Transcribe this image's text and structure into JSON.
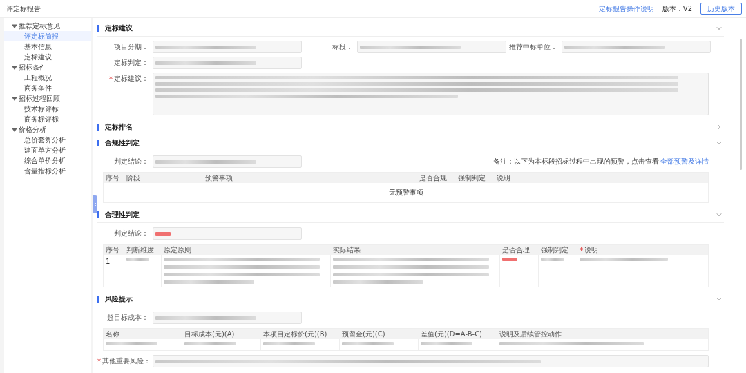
{
  "header": {
    "title": "评定标报告",
    "help_link": "定标报告操作说明",
    "version_label": "版本：",
    "version": "V2",
    "history_button": "历史版本"
  },
  "sidebar": {
    "items": [
      {
        "label": "推荐定标意见",
        "expanded": true,
        "children": [
          {
            "label": "评定标简报",
            "selected": true
          },
          {
            "label": "基本信息",
            "selected": false
          },
          {
            "label": "定标建议",
            "selected": false
          }
        ]
      },
      {
        "label": "招标条件",
        "expanded": true,
        "children": [
          {
            "label": "工程概况",
            "selected": false
          },
          {
            "label": "商务条件",
            "selected": false
          }
        ]
      },
      {
        "label": "招标过程回顾",
        "expanded": true,
        "children": [
          {
            "label": "技术标评标",
            "selected": false
          },
          {
            "label": "商务标评标",
            "selected": false
          }
        ]
      },
      {
        "label": "价格分析",
        "expanded": true,
        "children": [
          {
            "label": "总价套算分析",
            "selected": false
          },
          {
            "label": "建面单方分析",
            "selected": false
          },
          {
            "label": "综合单价分析",
            "selected": false
          },
          {
            "label": "含量指标分析",
            "selected": false
          }
        ]
      }
    ]
  },
  "sections": [
    {
      "kind": "form",
      "title": "定标建议",
      "expanded": true,
      "rows": [
        [
          {
            "label": "项目分期：",
            "kind": "input",
            "required": false,
            "blurred": true
          },
          {
            "label": "标段：",
            "kind": "input",
            "required": false,
            "blurred": true
          },
          {
            "label": "推荐中标单位：",
            "kind": "input",
            "required": false,
            "blurred": true
          }
        ],
        [
          {
            "label": "定标判定：",
            "kind": "input",
            "required": false,
            "blurred": true
          }
        ],
        [
          {
            "label": "定标建议：",
            "kind": "textarea",
            "required": true,
            "blurred": true
          }
        ]
      ]
    },
    {
      "kind": "form",
      "title": "定标排名",
      "expanded": false
    },
    {
      "kind": "table",
      "title": "合规性判定",
      "expanded": true,
      "field": {
        "label": "判定结论：",
        "required": false,
        "blurred": true,
        "alert": false
      },
      "note": "备注：以下为本标段招标过程中出现的预警，点击查看",
      "note_link": "全部预警及详情",
      "columns": [
        {
          "label": "序号",
          "kind": "index",
          "required": false
        },
        {
          "label": "阶段",
          "kind": "mid",
          "required": false
        },
        {
          "label": "预警事项",
          "kind": "fill",
          "required": false
        },
        {
          "label": "是否合规",
          "kind": "flag",
          "required": false
        },
        {
          "label": "强制判定",
          "kind": "flag",
          "required": false
        },
        {
          "label": "说明",
          "kind": "fill",
          "required": false
        }
      ],
      "empty_text": "无预警事项"
    },
    {
      "kind": "table",
      "title": "合理性判定",
      "expanded": true,
      "field": {
        "label": "判定结论：",
        "required": false,
        "blurred": true,
        "alert": true
      },
      "columns": [
        {
          "label": "序号",
          "kind": "index",
          "required": false
        },
        {
          "label": "判断维度",
          "kind": "tag",
          "required": false
        },
        {
          "label": "原定原则",
          "kind": "wide",
          "required": false
        },
        {
          "label": "实际结果",
          "kind": "wide",
          "required": false
        },
        {
          "label": "是否合理",
          "kind": "flag",
          "required": false
        },
        {
          "label": "强制判定",
          "kind": "flag",
          "required": false
        },
        {
          "label": "说明",
          "kind": "fill",
          "required": true
        }
      ],
      "rows": [
        [
          {
            "text": "1"
          },
          {
            "blurred": true,
            "alert": false,
            "multiline": false
          },
          {
            "blurred": true,
            "alert": false,
            "multiline": true
          },
          {
            "blurred": true,
            "alert": false,
            "multiline": true
          },
          {
            "blurred": true,
            "alert": true,
            "multiline": false
          },
          {
            "blurred": true,
            "alert": false,
            "multiline": false
          },
          {
            "blurred": true,
            "alert": false,
            "multiline": false
          }
        ]
      ]
    },
    {
      "kind": "table",
      "title": "风险提示",
      "expanded": true,
      "field": {
        "label": "超目标成本：",
        "required": false,
        "blurred": true,
        "alert": false
      },
      "columns": [
        {
          "label": "名称",
          "kind": "mid",
          "required": false
        },
        {
          "label": "目标成本(元)(A)",
          "kind": "mid",
          "required": false
        },
        {
          "label": "本项目定标价(元)(B)",
          "kind": "mid",
          "required": false
        },
        {
          "label": "预留金(元)(C)",
          "kind": "mid",
          "required": false
        },
        {
          "label": "差值(元)(D=A-B-C)",
          "kind": "mid",
          "required": false
        },
        {
          "label": "说明及后续管控动作",
          "kind": "fill",
          "required": false
        }
      ],
      "rows": [
        [
          {
            "blurred": true,
            "alert": false,
            "multiline": false
          },
          {
            "blurred": true,
            "alert": false,
            "multiline": false
          },
          {
            "blurred": true,
            "alert": false,
            "multiline": false
          },
          {
            "blurred": true,
            "alert": false,
            "multiline": false
          },
          {
            "blurred": true,
            "alert": false,
            "multiline": false
          },
          {
            "blurred": true,
            "alert": false,
            "multiline": false
          }
        ]
      ],
      "footer_field": {
        "label": "其他重要风险：",
        "required": true,
        "blurred": true,
        "alert": false
      }
    }
  ]
}
